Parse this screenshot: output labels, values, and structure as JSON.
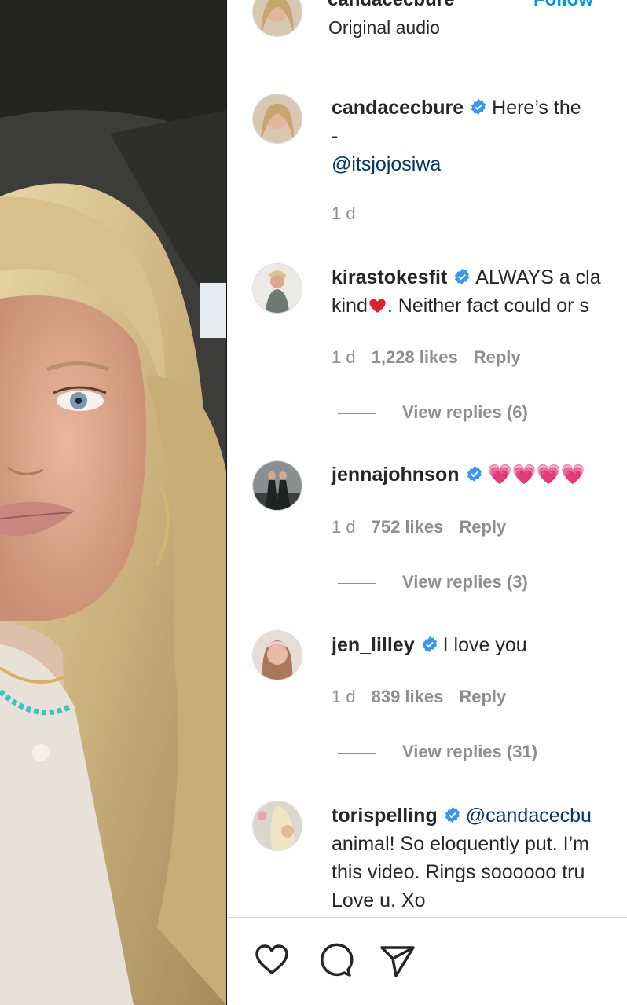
{
  "post": {
    "author": "candacecbure",
    "follow_label": "Follow",
    "audio": "Original audio"
  },
  "caption": {
    "username": "candacecbure",
    "text": "Here’s the",
    "line2": "-",
    "mention": "@itsjojosiwa",
    "time": "1 d"
  },
  "comments": [
    {
      "username": "kirastokesfit",
      "text_line1": "ALWAYS a cla",
      "text_line2_pre": "kind",
      "text_line2_post": ". Neither fact could or s",
      "time": "1 d",
      "likes": "1,228 likes",
      "reply_label": "Reply",
      "view_replies": "View replies (6)"
    },
    {
      "username": "jennajohnson",
      "emoji": "💗💗💗💗",
      "time": "1 d",
      "likes": "752 likes",
      "reply_label": "Reply",
      "view_replies": "View replies (3)"
    },
    {
      "username": "jen_lilley",
      "text": "I love you",
      "time": "1 d",
      "likes": "839 likes",
      "reply_label": "Reply",
      "view_replies": "View replies (31)"
    },
    {
      "username": "torispelling",
      "mention": "@candacecbu",
      "text_line2": "animal! So eloquently put. I’m",
      "text_line3": "this video. Rings soooooo tru",
      "text_line4": "Love u. Xo"
    }
  ],
  "actions": {
    "like_icon": "heart-icon",
    "comment_icon": "comment-icon",
    "share_icon": "send-icon"
  },
  "colors": {
    "verified": "#3897f0",
    "link": "#00376b",
    "follow": "#0095f6",
    "muted": "#8e8e8e"
  }
}
